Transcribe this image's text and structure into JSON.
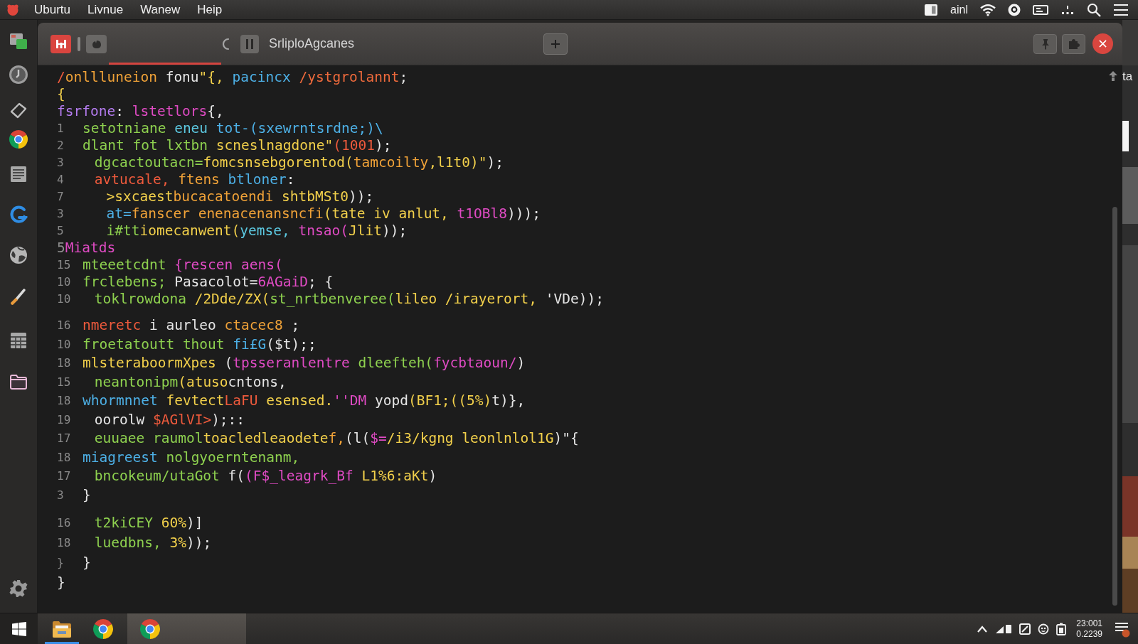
{
  "menu_bar": {
    "items": [
      "Uburtu",
      "Livnue",
      "Wanew",
      "Heip"
    ],
    "status_text": "ainl"
  },
  "window": {
    "tab_bar": {
      "tabs": [
        {
          "label": "SrliploAgcanes",
          "selected": true
        }
      ]
    },
    "editor": {
      "blocks": [
        {
          "lines": [
            {
              "tokens": [
                {
                  "text": "/",
                  "color": "#ee5a3c"
                },
                {
                  "text": "onllluneion ",
                  "color": "#f0a238"
                },
                {
                  "text": "fonu",
                  "color": "#e6e6e6"
                },
                {
                  "text": "\"{, ",
                  "color": "#f2d04b"
                },
                {
                  "text": "pacincx ",
                  "color": "#4db0e6"
                },
                {
                  "text": "/ystgrolannt",
                  "color": "#ee6a3c"
                },
                {
                  "text": ";",
                  "color": "#e6e6e6"
                }
              ]
            },
            {
              "tokens": [
                {
                  "text": "{",
                  "color": "#f2d04b"
                }
              ]
            },
            {
              "tokens": [
                {
                  "text": "fsrfone",
                  "color": "#b57cf0"
                },
                {
                  "text": ": ",
                  "color": "#e6e6e6"
                },
                {
                  "text": "lstetlors",
                  "color": "#e04bc4"
                },
                {
                  "text": "{,",
                  "color": "#e6e6e6"
                }
              ]
            },
            {
              "number": "1",
              "tokens": [
                {
                  "text": "setotniane ",
                  "color": "#8ed14f"
                },
                {
                  "text": "eneu ",
                  "color": "#5cc8e0"
                },
                {
                  "text": "tot-(sxewrntsrdne;)\\",
                  "color": "#4db0e6"
                }
              ]
            },
            {
              "number": "2",
              "tokens": [
                {
                  "text": "dlant fot lxtbn ",
                  "color": "#8ed14f"
                },
                {
                  "text": "scneslnagdone\"",
                  "color": "#f2d04b"
                },
                {
                  "text": "(1001",
                  "color": "#ee5a3c"
                },
                {
                  "text": ");",
                  "color": "#e6e6e6"
                }
              ]
            },
            {
              "number": "3",
              "tokens": [
                {
                  "text": " dgcactoutacn=",
                  "color": "#8ed14f"
                },
                {
                  "text": "fomcsnsebgorentod(",
                  "color": "#f2d04b"
                },
                {
                  "text": "tamcoilty",
                  "color": "#f0a238"
                },
                {
                  "text": ",l1t0)\"",
                  "color": "#f2d04b"
                },
                {
                  "text": ");",
                  "color": "#e6e6e6"
                }
              ]
            },
            {
              "number": "4",
              "tokens": [
                {
                  "text": " avtucale,",
                  "color": "#ee5a3c"
                },
                {
                  "text": " ftens ",
                  "color": "#f0a238"
                },
                {
                  "text": "btloner",
                  "color": "#4db0e6"
                },
                {
                  "text": ":",
                  "color": "#e6e6e6"
                }
              ]
            },
            {
              "number": "7",
              "tokens": [
                {
                  "text": "  >sxcaest",
                  "color": "#f2d04b"
                },
                {
                  "text": "bucacatoendi ",
                  "color": "#f0a238"
                },
                {
                  "text": "shtbMSt0",
                  "color": "#f2d04b"
                },
                {
                  "text": "));",
                  "color": "#e6e6e6"
                }
              ]
            },
            {
              "number": "3",
              "tokens": [
                {
                  "text": "  at=",
                  "color": "#4db0e6"
                },
                {
                  "text": "fanscer enenacenansncfi",
                  "color": "#f0a238"
                },
                {
                  "text": "(tate iv anlut, ",
                  "color": "#f2d04b"
                },
                {
                  "text": "t1OBl8",
                  "color": "#e04bc4"
                },
                {
                  "text": ")));",
                  "color": "#e6e6e6"
                }
              ]
            },
            {
              "number": "5",
              "tokens": [
                {
                  "text": "  i#tt",
                  "color": "#8ed14f"
                },
                {
                  "text": "iomecanwent(",
                  "color": "#f2d04b"
                },
                {
                  "text": "yemse,",
                  "color": "#5cc8e0"
                },
                {
                  "text": " tnsao(",
                  "color": "#e04bc4"
                },
                {
                  "text": "Jlit",
                  "color": "#f2d04b"
                },
                {
                  "text": "));",
                  "color": "#e6e6e6"
                }
              ]
            },
            {
              "tokens": [
                {
                  "text": "5",
                  "color": "#8c8c8c"
                },
                {
                  "text": "Miatds",
                  "color": "#e04bc4"
                }
              ]
            },
            {
              "number": "15",
              "tokens": [
                {
                  "text": "mteeetcdnt ",
                  "color": "#8ed14f"
                },
                {
                  "text": "{rescen aens(",
                  "color": "#e04bc4"
                }
              ]
            },
            {
              "number": "10",
              "tokens": [
                {
                  "text": "frclebens; ",
                  "color": "#8ed14f"
                },
                {
                  "text": "Pasacolot=",
                  "color": "#e6e6e6"
                },
                {
                  "text": "6AGaiD",
                  "color": "#e04bc4"
                },
                {
                  "text": "; {",
                  "color": "#e6e6e6"
                }
              ]
            },
            {
              "number": "10",
              "tokens": [
                {
                  "text": " toklrowdona ",
                  "color": "#8ed14f"
                },
                {
                  "text": "/2Dde/ZX(",
                  "color": "#f2d04b"
                },
                {
                  "text": "st_nrtbenveree(",
                  "color": "#8ed14f"
                },
                {
                  "text": "lileo /irayerort, ",
                  "color": "#f2d04b"
                },
                {
                  "text": "'VDe));",
                  "color": "#e6e6e6"
                }
              ]
            }
          ]
        },
        {
          "lines": [
            {
              "number": "16",
              "tokens": [
                {
                  "text": "nmeretc",
                  "color": "#ee5a3c"
                },
                {
                  "text": " i aurleo ",
                  "color": "#e6e6e6"
                },
                {
                  "text": "ctacec8",
                  "color": "#f0a238"
                },
                {
                  "text": " ;",
                  "color": "#e6e6e6"
                }
              ]
            },
            {
              "number": "10",
              "tokens": [
                {
                  "text": "froetatoutt thout ",
                  "color": "#8ed14f"
                },
                {
                  "text": "fi£G",
                  "color": "#4db0e6"
                },
                {
                  "text": "($t);;",
                  "color": "#e6e6e6"
                }
              ]
            },
            {
              "number": "18",
              "tokens": [
                {
                  "text": "mlsteraboormXpes ",
                  "color": "#f2d04b"
                },
                {
                  "text": "(",
                  "color": "#e6e6e6"
                },
                {
                  "text": "tpsseranlentre ",
                  "color": "#e04bc4"
                },
                {
                  "text": "dleefteh(",
                  "color": "#8ed14f"
                },
                {
                  "text": "fycbtaoun/",
                  "color": "#e04bc4"
                },
                {
                  "text": ")",
                  "color": "#e6e6e6"
                }
              ]
            },
            {
              "number": "15",
              "tokens": [
                {
                  "text": " neantonipm",
                  "color": "#8ed14f"
                },
                {
                  "text": "(atuso",
                  "color": "#f2d04b"
                },
                {
                  "text": "cntons,",
                  "color": "#e6e6e6"
                }
              ]
            },
            {
              "number": "18",
              "tokens": [
                {
                  "text": "whormnnet ",
                  "color": "#4db0e6"
                },
                {
                  "text": "fevtect",
                  "color": "#f2d04b"
                },
                {
                  "text": "LaFU",
                  "color": "#ee5a3c"
                },
                {
                  "text": " esensed.",
                  "color": "#f2d04b"
                },
                {
                  "text": "''DM",
                  "color": "#e04bc4"
                },
                {
                  "text": " yopd",
                  "color": "#e6e6e6"
                },
                {
                  "text": "(BF1;((5%)",
                  "color": "#f2d04b"
                },
                {
                  "text": "t)},",
                  "color": "#e6e6e6"
                }
              ]
            },
            {
              "number": "19",
              "tokens": [
                {
                  "text": " oorolw ",
                  "color": "#e6e6e6"
                },
                {
                  "text": "$AGlVI>",
                  "color": "#ee5a3c"
                },
                {
                  "text": ");::",
                  "color": "#e6e6e6"
                }
              ]
            },
            {
              "number": "17",
              "tokens": [
                {
                  "text": " euuaee raumol",
                  "color": "#8ed14f"
                },
                {
                  "text": "toacledleaodete",
                  "color": "#f2d04b"
                },
                {
                  "text": "f,",
                  "color": "#f0a238"
                },
                {
                  "text": "(l(",
                  "color": "#e6e6e6"
                },
                {
                  "text": "$=",
                  "color": "#e04bc4"
                },
                {
                  "text": "/i3/kgng leonlnlol1G",
                  "color": "#f2d04b"
                },
                {
                  "text": ")\"{",
                  "color": "#e6e6e6"
                }
              ]
            },
            {
              "number": "18",
              "tokens": [
                {
                  "text": "miagreest ",
                  "color": "#4db0e6"
                },
                {
                  "text": "nolgyoerntenanm,",
                  "color": "#8ed14f"
                }
              ]
            },
            {
              "number": "17",
              "tokens": [
                {
                  "text": " bncokeum/utaGot ",
                  "color": "#8ed14f"
                },
                {
                  "text": "f(",
                  "color": "#e6e6e6"
                },
                {
                  "text": "(F$_leagrk_Bf ",
                  "color": "#e04bc4"
                },
                {
                  "text": "L1%6:aKt",
                  "color": "#f2d04b"
                },
                {
                  "text": ")",
                  "color": "#e6e6e6"
                }
              ]
            },
            {
              "number": "3",
              "tokens": [
                {
                  "text": "}",
                  "color": "#e6e6e6"
                }
              ]
            }
          ]
        },
        {
          "lines": [
            {
              "number": "16",
              "tokens": [
                {
                  "text": " t2kiCEY",
                  "color": "#8ed14f"
                },
                {
                  "text": " 60%",
                  "color": "#f2d04b"
                },
                {
                  "text": ")]",
                  "color": "#e6e6e6"
                }
              ]
            },
            {
              "number": "18",
              "tokens": [
                {
                  "text": " luedbns,",
                  "color": "#8ed14f"
                },
                {
                  "text": " 3%",
                  "color": "#f2d04b"
                },
                {
                  "text": "));",
                  "color": "#e6e6e6"
                }
              ]
            },
            {
              "number": "}",
              "tokens": [
                {
                  "text": "}",
                  "color": "#e6e6e6"
                }
              ]
            },
            {
              "tokens": [
                {
                  "text": "}",
                  "color": "#e6e6e6"
                }
              ]
            }
          ]
        }
      ]
    }
  },
  "background_window": {
    "text": "ta"
  },
  "taskbar": {
    "items": [
      {
        "kind": "folder",
        "running": true,
        "selected": false
      },
      {
        "kind": "ring",
        "running": false,
        "selected": false
      },
      {
        "kind": "ring",
        "running": false,
        "selected": true
      }
    ],
    "clock": {
      "time": "23:001",
      "date": "0.2239"
    }
  }
}
